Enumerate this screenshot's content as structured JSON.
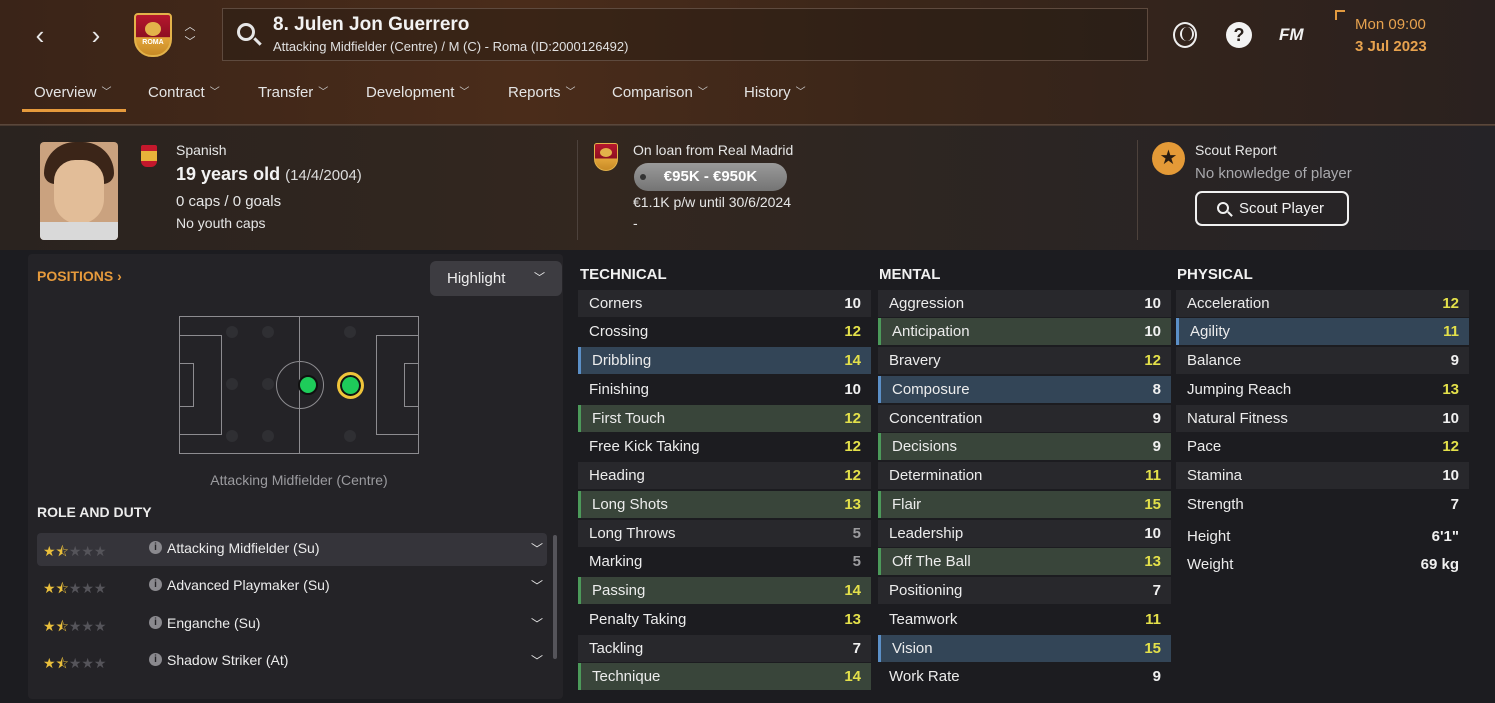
{
  "header": {
    "player_title": "8. Julen Jon Guerrero",
    "player_subtitle": "Attacking Midfielder (Centre) / M (C) - Roma (ID:2000126492)",
    "club_crest_text": "ROMA",
    "back_icon": "chevron-left-icon",
    "forward_icon": "chevron-right-icon",
    "date_line1": "Mon 09:00",
    "date_line2": "3 Jul 2023",
    "fm_label": "FM",
    "help_label": "?"
  },
  "tabs": [
    {
      "label": "Overview",
      "active": true
    },
    {
      "label": "Contract"
    },
    {
      "label": "Transfer"
    },
    {
      "label": "Development"
    },
    {
      "label": "Reports"
    },
    {
      "label": "Comparison"
    },
    {
      "label": "History"
    }
  ],
  "info": {
    "nationality": "Spanish",
    "age": "19 years old",
    "dob": "(14/4/2004)",
    "caps": "0 caps / 0 goals",
    "youth_caps": "No youth caps",
    "loan": "On loan from Real Madrid",
    "value": "€95K - €950K",
    "wage": "€1.1K p/w until 30/6/2024",
    "dash": "-",
    "scout_title": "Scout Report",
    "scout_knowledge": "No knowledge of player",
    "scout_button": "Scout Player"
  },
  "positions": {
    "title": "POSITIONS",
    "highlight_label": "Highlight",
    "position_label": "Attacking Midfielder (Centre)"
  },
  "roles": {
    "title": "ROLE AND DUTY",
    "items": [
      {
        "name": "Attacking Midfielder (Su)",
        "stars": 1.5
      },
      {
        "name": "Advanced Playmaker (Su)",
        "stars": 1.5
      },
      {
        "name": "Enganche (Su)",
        "stars": 1.5
      },
      {
        "name": "Shadow Striker (At)",
        "stars": 1.5
      }
    ]
  },
  "attributes": {
    "technical": {
      "title": "TECHNICAL",
      "items": [
        {
          "name": "Corners",
          "value": "10"
        },
        {
          "name": "Crossing",
          "value": "12"
        },
        {
          "name": "Dribbling",
          "value": "14"
        },
        {
          "name": "Finishing",
          "value": "10"
        },
        {
          "name": "First Touch",
          "value": "12"
        },
        {
          "name": "Free Kick Taking",
          "value": "12"
        },
        {
          "name": "Heading",
          "value": "12"
        },
        {
          "name": "Long Shots",
          "value": "13"
        },
        {
          "name": "Long Throws",
          "value": "5"
        },
        {
          "name": "Marking",
          "value": "5"
        },
        {
          "name": "Passing",
          "value": "14"
        },
        {
          "name": "Penalty Taking",
          "value": "13"
        },
        {
          "name": "Tackling",
          "value": "7"
        },
        {
          "name": "Technique",
          "value": "14"
        }
      ]
    },
    "mental": {
      "title": "MENTAL",
      "items": [
        {
          "name": "Aggression",
          "value": "10"
        },
        {
          "name": "Anticipation",
          "value": "10"
        },
        {
          "name": "Bravery",
          "value": "12"
        },
        {
          "name": "Composure",
          "value": "8"
        },
        {
          "name": "Concentration",
          "value": "9"
        },
        {
          "name": "Decisions",
          "value": "9"
        },
        {
          "name": "Determination",
          "value": "11"
        },
        {
          "name": "Flair",
          "value": "15"
        },
        {
          "name": "Leadership",
          "value": "10"
        },
        {
          "name": "Off The Ball",
          "value": "13"
        },
        {
          "name": "Positioning",
          "value": "7"
        },
        {
          "name": "Teamwork",
          "value": "11"
        },
        {
          "name": "Vision",
          "value": "15"
        },
        {
          "name": "Work Rate",
          "value": "9"
        }
      ]
    },
    "physical": {
      "title": "PHYSICAL",
      "items": [
        {
          "name": "Acceleration",
          "value": "12"
        },
        {
          "name": "Agility",
          "value": "11"
        },
        {
          "name": "Balance",
          "value": "9"
        },
        {
          "name": "Jumping Reach",
          "value": "13"
        },
        {
          "name": "Natural Fitness",
          "value": "10"
        },
        {
          "name": "Pace",
          "value": "12"
        },
        {
          "name": "Stamina",
          "value": "10"
        },
        {
          "name": "Strength",
          "value": "7"
        },
        {
          "name": "Height",
          "value": "6'1\""
        },
        {
          "name": "Weight",
          "value": "69 kg"
        }
      ]
    }
  },
  "colors": {
    "accent": "#e69a3c",
    "value_high": "#e3e04a",
    "value_normal": "#f0f0f0",
    "value_low": "#9d9da0",
    "highlight_green": "#39453a",
    "highlight_blue": "#334557"
  }
}
